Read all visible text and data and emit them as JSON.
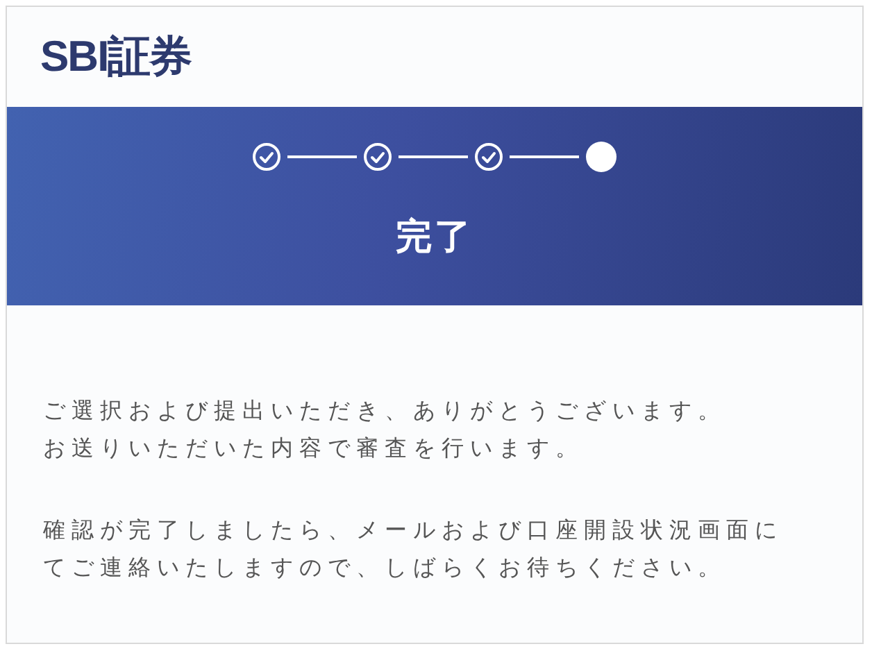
{
  "logo": "SBI証券",
  "steps": [
    {
      "done": true
    },
    {
      "done": true
    },
    {
      "done": true
    },
    {
      "done": false
    }
  ],
  "title": "完了",
  "paragraphs": [
    [
      "ご選択および提出いただき、ありがとうございます。",
      "お送りいただいた内容で審査を行います。"
    ],
    [
      "確認が完了しましたら、メールおよび口座開設状況画面に",
      "てご連絡いたしますので、しばらくお待ちください。"
    ]
  ]
}
